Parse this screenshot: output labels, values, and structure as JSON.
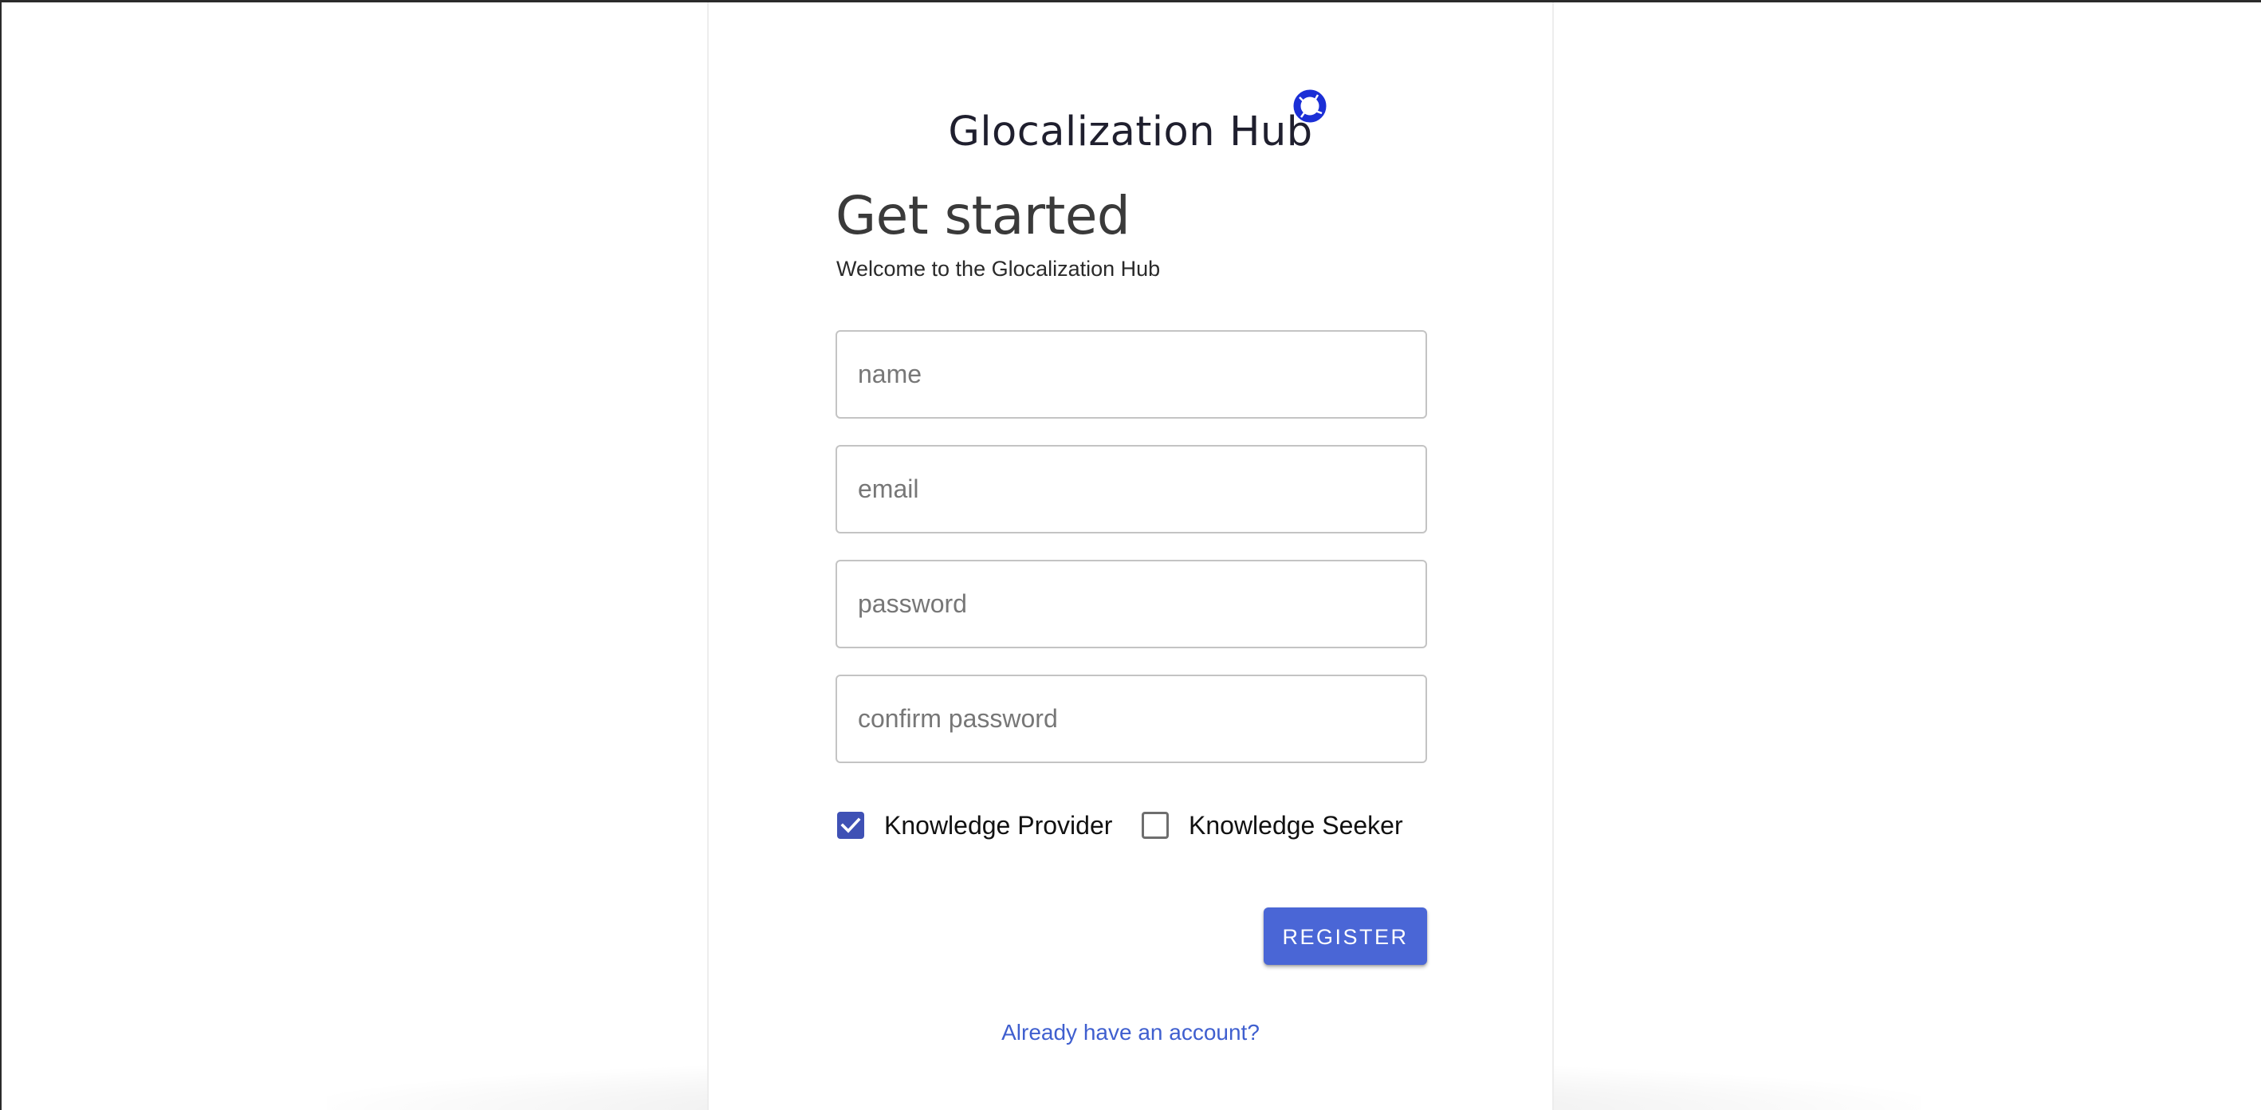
{
  "brand": {
    "name_part1": "Glocalization",
    "name_part2": "Hub",
    "logo_icon": "ring-logo-icon",
    "accent_color": "#1b2fd6"
  },
  "header": {
    "title": "Get started",
    "subtitle": "Welcome to the Glocalization Hub"
  },
  "form": {
    "name": {
      "placeholder": "name",
      "value": ""
    },
    "email": {
      "placeholder": "email",
      "value": ""
    },
    "password": {
      "placeholder": "password",
      "value": ""
    },
    "confirm_password": {
      "placeholder": "confirm password",
      "value": ""
    }
  },
  "roles": [
    {
      "label": "Knowledge Provider",
      "checked": true
    },
    {
      "label": "Knowledge Seeker",
      "checked": false
    }
  ],
  "actions": {
    "register_label": "REGISTER",
    "register_color": "#4a66d6",
    "login_link": "Already have an account?",
    "link_color": "#3f5fcf"
  }
}
